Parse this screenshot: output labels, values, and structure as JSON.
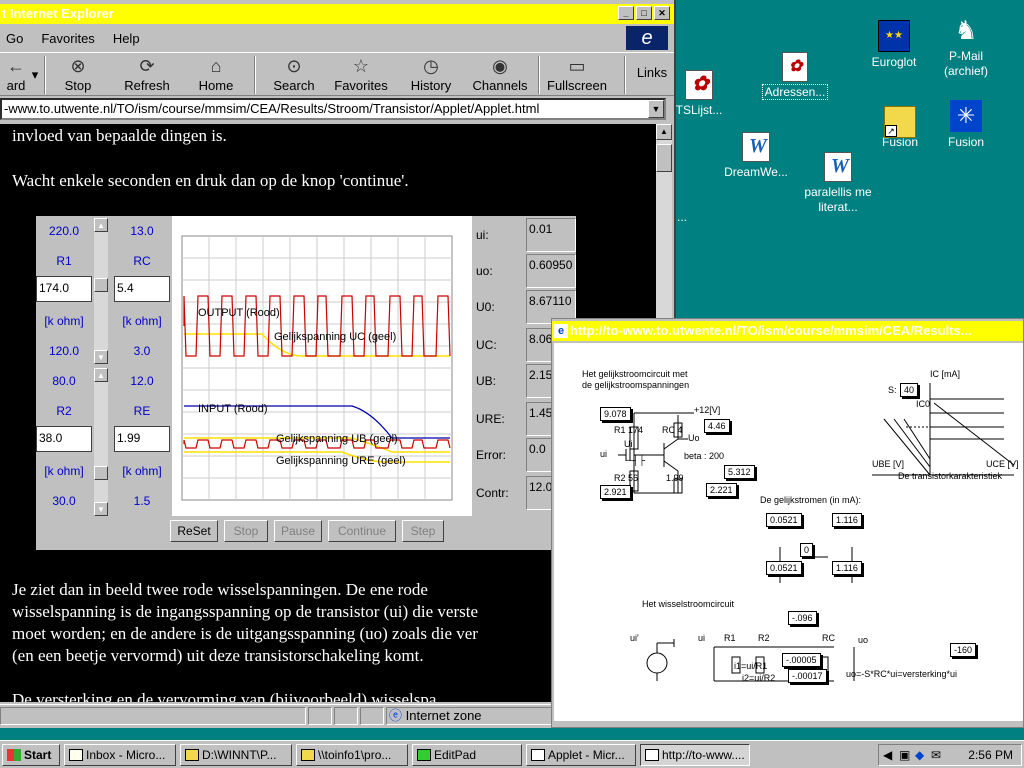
{
  "desktop": {
    "icons": [
      {
        "id": "tslijst",
        "label": "TSLijst...",
        "type": "doc"
      },
      {
        "id": "adressen",
        "label": "Adressen...",
        "type": "doc"
      },
      {
        "id": "dreamwe",
        "label": "DreamWe...",
        "type": "doc"
      },
      {
        "id": "paralellis",
        "label": "paralellis me literat...",
        "type": "doc"
      },
      {
        "id": "euroglot",
        "label": "Euroglot",
        "type": "app"
      },
      {
        "id": "pmail",
        "label": "P-Mail (archief)",
        "type": "app"
      },
      {
        "id": "fusion1",
        "label": "Fusion",
        "type": "folder"
      },
      {
        "id": "fusion2",
        "label": "Fusion",
        "type": "app"
      },
      {
        "id": "clipped",
        "label": "...",
        "type": "text"
      }
    ]
  },
  "ie": {
    "title": "t Internet Explorer",
    "menu": [
      "Go",
      "Favorites",
      "Help"
    ],
    "toolbar": [
      {
        "label": "ard",
        "icon": "back-icon"
      },
      {
        "label": "Stop",
        "icon": "stop-icon"
      },
      {
        "label": "Refresh",
        "icon": "refresh-icon"
      },
      {
        "label": "Home",
        "icon": "home-icon"
      },
      {
        "label": "Search",
        "icon": "search-icon"
      },
      {
        "label": "Favorites",
        "icon": "favorites-icon"
      },
      {
        "label": "History",
        "icon": "history-icon"
      },
      {
        "label": "Channels",
        "icon": "channels-icon"
      },
      {
        "label": "Fullscreen",
        "icon": "fullscreen-icon"
      }
    ],
    "links_label": "Links",
    "address": "-www.to.utwente.nl/TO/ism/course/mmsim/CEA/Results/Stroom/Transistor/Applet/Applet.html",
    "status_zone": "Internet zone",
    "content": {
      "line1": "invloed van bepaalde dingen is.",
      "line2": "Wacht enkele seconden en druk dan op de knop 'continue'.",
      "para": [
        "Je ziet dan in beeld twee rode wisselspanningen. De ene rode",
        "wisselspanning is de ingangsspanning op de transistor (ui) die verste",
        "moet worden; en de andere is de uitgangsspanning (uo) zoals die ver",
        "(en een beetje vervormd) uit deze transistorschakeling komt."
      ],
      "clipped_line": "De versterking en de vervorming van (bijvoorbeeld) wisselspa"
    }
  },
  "applet": {
    "col1": {
      "top": "220.0",
      "r1_label": "R1",
      "r1_value": "174.0",
      "unit1": "[k ohm]",
      "mid1": "120.0",
      "mid2": "80.0",
      "r2_label": "R2",
      "r2_value": "38.0",
      "unit2": "[k ohm]",
      "bottom": "30.0"
    },
    "col2": {
      "top": "13.0",
      "rc_label": "RC",
      "rc_value": "5.4",
      "unit1": "[k ohm]",
      "mid1": "3.0",
      "mid2": "12.0",
      "re_label": "RE",
      "re_value": "1.99",
      "unit2": "[k ohm]",
      "bottom": "1.5"
    },
    "plot_labels": {
      "output": "OUTPUT (Rood)",
      "uc": "Gelijkspanning UC (geel)",
      "input": "INPUT (Rood)",
      "ub": "Gelijkspanning UB (geel)",
      "ure": "Gelijkspanning URE (geel)"
    },
    "readouts": [
      {
        "label": "ui:",
        "value": "0.01"
      },
      {
        "label": "uo:",
        "value": "0.60950"
      },
      {
        "label": "U0:",
        "value": "8.67110"
      },
      {
        "label": "UC:",
        "value": "8.06"
      },
      {
        "label": "UB:",
        "value": "2.15"
      },
      {
        "label": "URE:",
        "value": "1.45"
      },
      {
        "label": "Error:",
        "value": "0.0"
      },
      {
        "label": "Contr:",
        "value": "12.0"
      }
    ],
    "buttons": {
      "reset": "ReSet",
      "stop": "Stop",
      "pause": "Pause",
      "continue": "Continue",
      "step": "Step"
    }
  },
  "popup": {
    "title": "http://to-www.to.utwente.nl/TO/ism/course/mmsim/CEA/Results...",
    "circuit_title": [
      "Het gelijkstroomcircuit met",
      "de gelijkstroomspanningen"
    ],
    "v_9078": "9.078",
    "plus12": "+12[V]",
    "r1": "R1  174",
    "rc": "RC  4",
    "v_446": "4.46",
    "uo": "Uo",
    "ui": "Ui",
    "ui2": "ui",
    "beta": "beta : 200",
    "v_5312": "5.312",
    "r2": "R2   56",
    "re_val": "1.99",
    "v_2921": "2.921",
    "v_2221": "2.221",
    "ic_label": "IC [mA]",
    "s_label": "S:",
    "s_value": "40",
    "ico": "IC0",
    "ube": "UBE [V]",
    "uce": "UCE [V]",
    "kar": "De transistorkarakteristiek",
    "currents_title": "De gelijkstromen (in mA):",
    "c1": "0.0521",
    "c2": "1.116",
    "c3": "0",
    "c4": "0.0521",
    "c5": "1.116",
    "ac_title": "Het wisselstroomcircuit",
    "ac_ui1": "ui'",
    "ac_ui": "ui",
    "ac_r1": "R1",
    "ac_r2": "R2",
    "ac_rc": "RC",
    "ac_uo": "uo",
    "v_096": "-.096",
    "v_00005": "-.00005",
    "v_00017": "-.00017",
    "i1": "i1=ui/R1",
    "i2": "i2=ui/R2",
    "v_160": "-160",
    "formula": "uo=-S*RC*ui=versterking*ui"
  },
  "taskbar": {
    "start": "Start",
    "tasks": [
      "Inbox - Micro...",
      "D:\\WINNT\\P...",
      "\\\\toinfo1\\pro...",
      "EditPad",
      "Applet - Micr...",
      "http://to-www...."
    ],
    "clock": "2:56 PM"
  },
  "colors": {
    "desktop": "#008080",
    "titlebar": "#ffff00",
    "applet_bg": "#c0c0c0",
    "plot_red": "#cc0000",
    "plot_blue": "#0000aa",
    "plot_yellow": "#ffe000"
  }
}
